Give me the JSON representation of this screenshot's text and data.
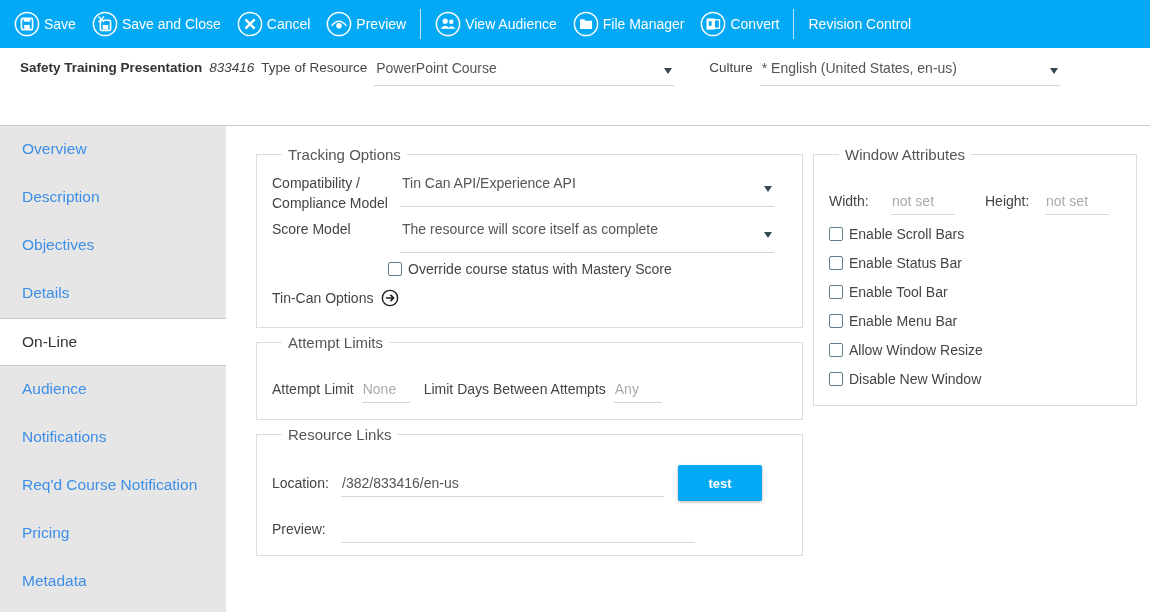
{
  "toolbar": {
    "groups": [
      {
        "buttons": [
          {
            "label": "Save",
            "kind": "save"
          },
          {
            "label": "Save and Close",
            "kind": "save-close"
          },
          {
            "label": "Cancel",
            "kind": "cancel"
          },
          {
            "label": "Preview",
            "kind": "preview"
          }
        ]
      },
      {
        "buttons": [
          {
            "label": "View Audience",
            "kind": "audience"
          },
          {
            "label": "File Manager",
            "kind": "folder"
          },
          {
            "label": "Convert",
            "kind": "convert"
          }
        ]
      },
      {
        "buttons": [
          {
            "label": "Revision Control",
            "kind": "text"
          }
        ]
      }
    ]
  },
  "header": {
    "title": "Safety Training Presentation",
    "id": "833416",
    "type_label": "Type of Resource",
    "type_value": "PowerPoint Course",
    "culture_label": "Culture",
    "culture_value": "* English (United States, en-us)"
  },
  "sidebar": {
    "items": [
      {
        "label": "Overview",
        "selected": false
      },
      {
        "label": "Description",
        "selected": false
      },
      {
        "label": "Objectives",
        "selected": false
      },
      {
        "label": "Details",
        "selected": false
      },
      {
        "label": "On-Line",
        "selected": true
      },
      {
        "label": "Audience",
        "selected": false
      },
      {
        "label": "Notifications",
        "selected": false
      },
      {
        "label": "Req'd Course Notification",
        "selected": false
      },
      {
        "label": "Pricing",
        "selected": false
      },
      {
        "label": "Metadata",
        "selected": false
      }
    ]
  },
  "tracking": {
    "title": "Tracking Options",
    "compat_label": "Compatibility / Compliance Model",
    "compat_value": "Tin Can API/Experience API",
    "score_label": "Score Model",
    "score_value": "The resource will score itself as complete",
    "override": {
      "label": "Override course status with Mastery Score",
      "checked": false
    },
    "tincan_label": "Tin-Can Options"
  },
  "attempts": {
    "title": "Attempt Limits",
    "limit_label": "Attempt Limit",
    "limit_placeholder": "None",
    "days_label": "Limit Days Between Attempts",
    "days_placeholder": "Any"
  },
  "links": {
    "title": "Resource Links",
    "location_label": "Location:",
    "location_value": "/382/833416/en-us",
    "test_button": "test",
    "preview_label": "Preview:"
  },
  "window_attributes": {
    "title": "Window Attributes",
    "width_label": "Width:",
    "width_placeholder": "not set",
    "height_label": "Height:",
    "height_placeholder": "not set",
    "options": [
      {
        "label": "Enable Scroll Bars",
        "checked": false
      },
      {
        "label": "Enable Status Bar",
        "checked": false
      },
      {
        "label": "Enable Tool Bar",
        "checked": false
      },
      {
        "label": "Enable Menu Bar",
        "checked": false
      },
      {
        "label": "Allow Window Resize",
        "checked": false
      },
      {
        "label": "Disable New Window",
        "checked": false
      }
    ]
  }
}
